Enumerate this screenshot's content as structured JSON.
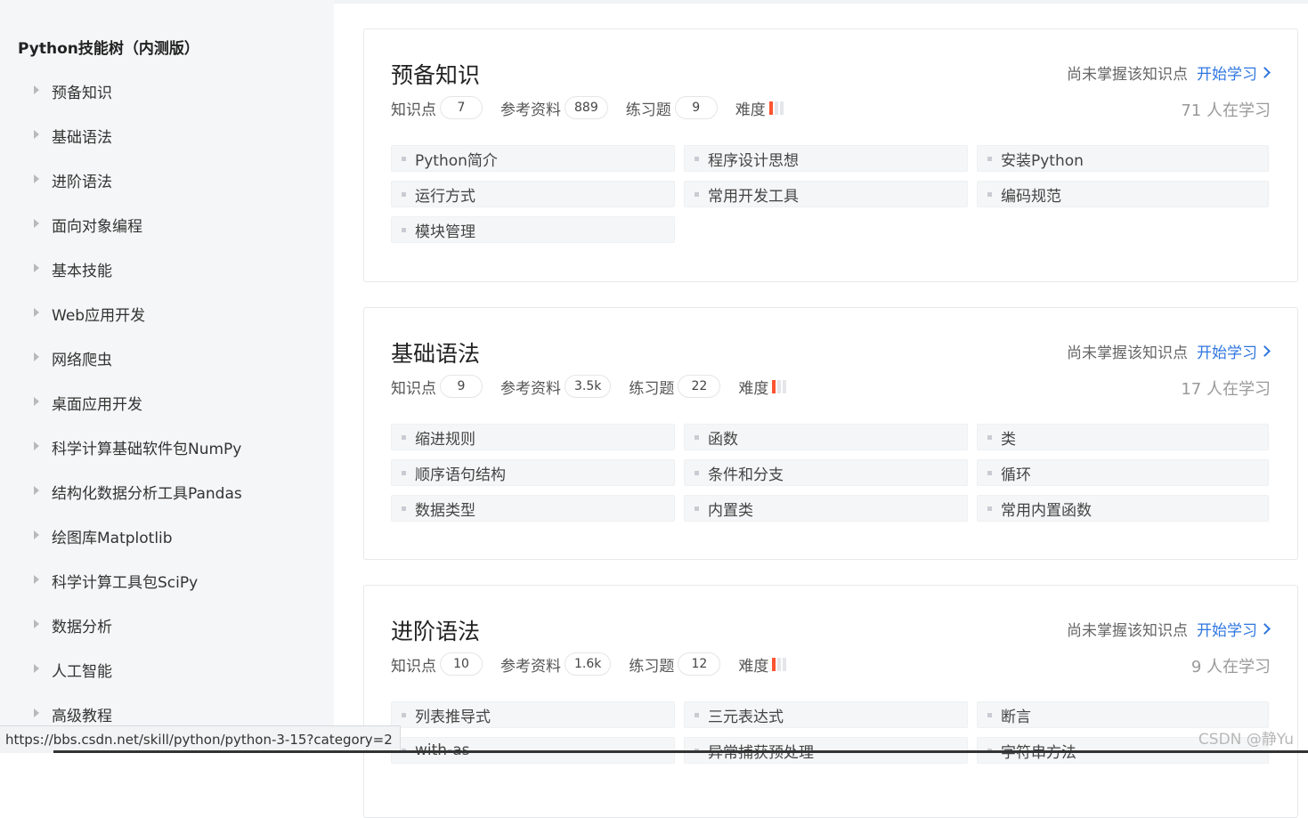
{
  "sidebar": {
    "title": "Python技能树（内测版）",
    "items": [
      {
        "label": "预备知识"
      },
      {
        "label": "基础语法"
      },
      {
        "label": "进阶语法"
      },
      {
        "label": "面向对象编程"
      },
      {
        "label": "基本技能"
      },
      {
        "label": "Web应用开发"
      },
      {
        "label": "网络爬虫"
      },
      {
        "label": "桌面应用开发"
      },
      {
        "label": "科学计算基础软件包NumPy"
      },
      {
        "label": "结构化数据分析工具Pandas"
      },
      {
        "label": "绘图库Matplotlib"
      },
      {
        "label": "科学计算工具包SciPy"
      },
      {
        "label": "数据分析"
      },
      {
        "label": "人工智能"
      },
      {
        "label": "高级教程"
      }
    ]
  },
  "labels": {
    "status": "尚未掌握该知识点",
    "start": "开始学习",
    "points": "知识点",
    "refs": "参考资料",
    "exercises": "练习题",
    "difficulty": "难度"
  },
  "cards": [
    {
      "title": "预备知识",
      "points": "7",
      "refs": "889",
      "exercises": "9",
      "difficulty_level": 1,
      "difficulty_max": 3,
      "learners": "71 人在学习",
      "tags": [
        "Python简介",
        "程序设计思想",
        "安装Python",
        "运行方式",
        "常用开发工具",
        "编码规范",
        "模块管理"
      ]
    },
    {
      "title": "基础语法",
      "points": "9",
      "refs": "3.5k",
      "exercises": "22",
      "difficulty_level": 1,
      "difficulty_max": 3,
      "learners": "17 人在学习",
      "tags": [
        "缩进规则",
        "函数",
        "类",
        "顺序语句结构",
        "条件和分支",
        "循环",
        "数据类型",
        "内置类",
        "常用内置函数"
      ]
    },
    {
      "title": "进阶语法",
      "points": "10",
      "refs": "1.6k",
      "exercises": "12",
      "difficulty_level": 1,
      "difficulty_max": 3,
      "learners": "9 人在学习",
      "tags": [
        "列表推导式",
        "三元表达式",
        "断言",
        "with-as",
        "异常捕获预处理",
        "字符串方法"
      ]
    }
  ],
  "status_url": "https://bbs.csdn.net/skill/python/python-3-15?category=2",
  "watermark": "CSDN @静Yu"
}
